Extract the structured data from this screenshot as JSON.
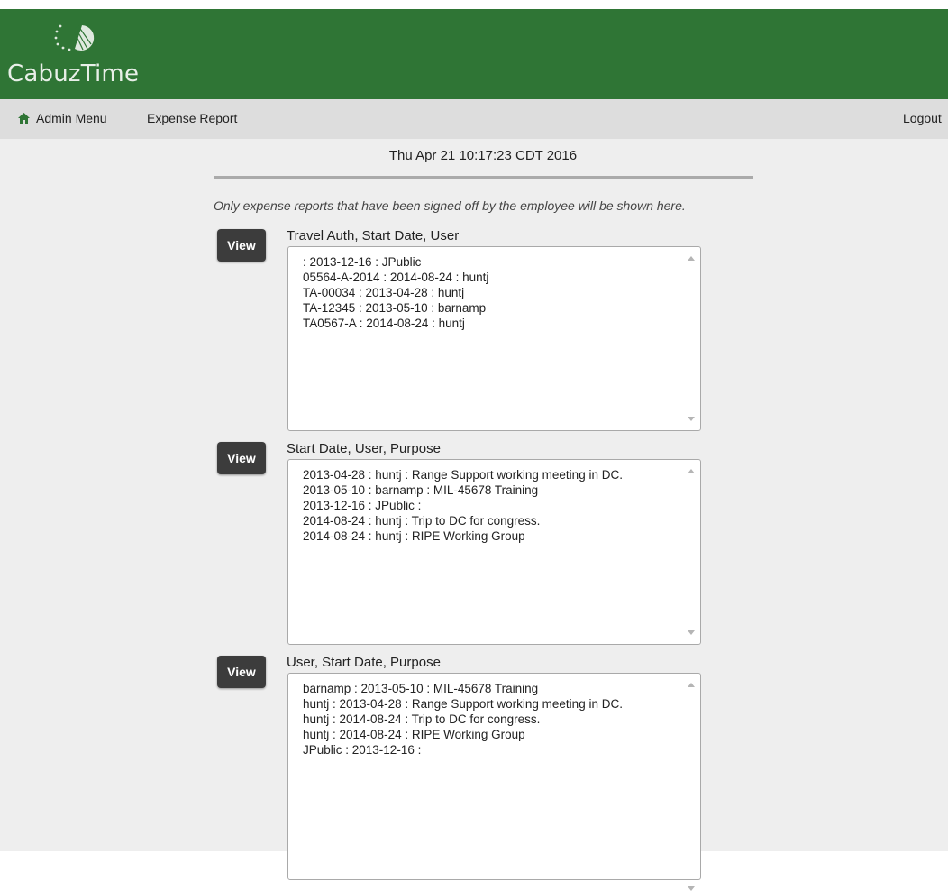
{
  "app": {
    "name": "CabuzTime",
    "brand_color": "#2f7535"
  },
  "nav": {
    "admin_menu": "Admin Menu",
    "expense_report": "Expense Report",
    "logout": "Logout",
    "home_icon": "home-icon"
  },
  "main": {
    "timestamp": "Thu Apr 21 10:17:23 CDT 2016",
    "note": "Only expense reports that have been signed off by the employee will be shown here.",
    "lists": [
      {
        "button_label": "View",
        "label": "Travel Auth, Start Date, User",
        "options": [
          ": 2013-12-16 : JPublic",
          "05564-A-2014 : 2014-08-24 : huntj",
          "TA-00034 : 2013-04-28 : huntj",
          "TA-12345 : 2013-05-10 : barnamp",
          "TA0567-A : 2014-08-24 : huntj"
        ]
      },
      {
        "button_label": "View",
        "label": "Start Date, User, Purpose",
        "options": [
          "2013-04-28 : huntj : Range Support working meeting in DC.",
          "2013-05-10 : barnamp : MIL-45678 Training",
          "2013-12-16 : JPublic :",
          "2014-08-24 : huntj : Trip to DC for congress.",
          "2014-08-24 : huntj : RIPE Working Group"
        ]
      },
      {
        "button_label": "View",
        "label": "User, Start Date, Purpose",
        "options": [
          "barnamp : 2013-05-10 : MIL-45678 Training",
          "huntj : 2013-04-28 : Range Support working meeting in DC.",
          "huntj : 2014-08-24 : Trip to DC for congress.",
          "huntj : 2014-08-24 : RIPE Working Group",
          "JPublic : 2013-12-16 :"
        ]
      }
    ]
  }
}
